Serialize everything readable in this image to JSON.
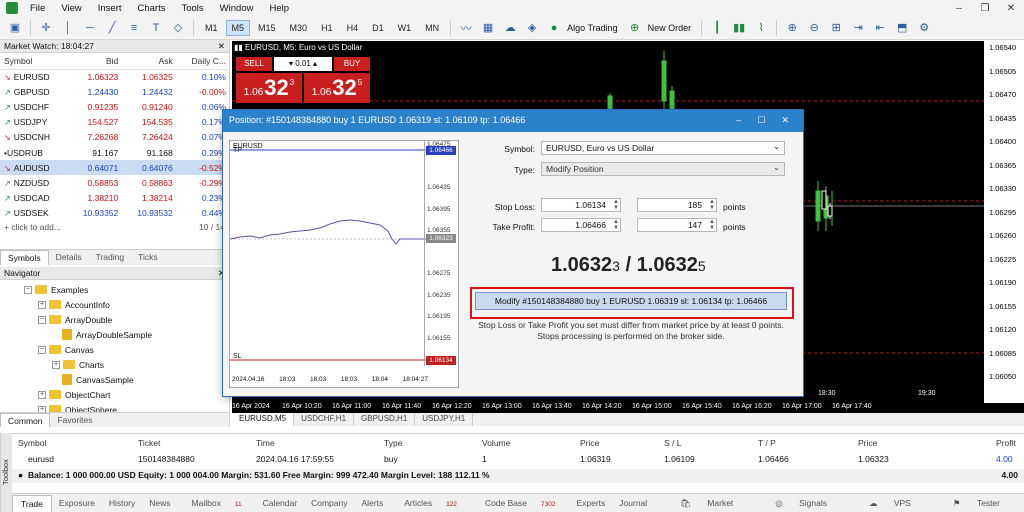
{
  "menu": [
    "File",
    "View",
    "Insert",
    "Charts",
    "Tools",
    "Window",
    "Help"
  ],
  "toolbar": {
    "timeframes": [
      "M1",
      "M5",
      "M15",
      "M30",
      "H1",
      "H4",
      "D1",
      "W1",
      "MN"
    ],
    "active_tf": "M5",
    "algo_trading": "Algo Trading",
    "new_order": "New Order"
  },
  "market_watch": {
    "title": "Market Watch: 18:04:27",
    "columns": [
      "Symbol",
      "Bid",
      "Ask",
      "Daily C..."
    ],
    "rows": [
      {
        "symbol": "EURUSD",
        "bid": "1.06323",
        "ask": "1.06325",
        "change": "0.10%",
        "dir": "down",
        "color": "red"
      },
      {
        "symbol": "GBPUSD",
        "bid": "1.24430",
        "ask": "1.24432",
        "change": "-0.00%",
        "dir": "up",
        "color": "blue"
      },
      {
        "symbol": "USDCHF",
        "bid": "0.91235",
        "ask": "0.91240",
        "change": "0.06%",
        "dir": "up",
        "color": "red"
      },
      {
        "symbol": "USDJPY",
        "bid": "154.527",
        "ask": "154.535",
        "change": "0.17%",
        "dir": "up",
        "color": "red"
      },
      {
        "symbol": "USDCNH",
        "bid": "7.26268",
        "ask": "7.26424",
        "change": "0.07%",
        "dir": "down",
        "color": "red"
      },
      {
        "symbol": "USDRUB",
        "bid": "91.167",
        "ask": "91.168",
        "change": "0.29%",
        "dir": "dot",
        "color": "black"
      },
      {
        "symbol": "AUDUSD",
        "bid": "0.64071",
        "ask": "0.64076",
        "change": "-0.52%",
        "dir": "down",
        "color": "blue"
      },
      {
        "symbol": "NZDUSD",
        "bid": "0.58853",
        "ask": "0.58863",
        "change": "-0.29%",
        "dir": "up",
        "color": "red"
      },
      {
        "symbol": "USDCAD",
        "bid": "1.38210",
        "ask": "1.38214",
        "change": "0.23%",
        "dir": "up",
        "color": "red"
      },
      {
        "symbol": "USDSEK",
        "bid": "10.93352",
        "ask": "10.93532",
        "change": "0.44%",
        "dir": "up",
        "color": "blue"
      }
    ],
    "add_placeholder": "+ click to add...",
    "count": "10 / 14",
    "tabs": [
      "Symbols",
      "Details",
      "Trading",
      "Ticks"
    ]
  },
  "navigator": {
    "title": "Navigator",
    "items": [
      "Examples",
      "AccountInfo",
      "ArrayDouble",
      "ArrayDoubleSample",
      "Canvas",
      "Charts",
      "CanvasSample",
      "ObjectChart",
      "ObjectSphere"
    ],
    "tabs": [
      "Common",
      "Favorites"
    ]
  },
  "chart": {
    "header": "EURUSD, M5:  Euro vs US Dollar",
    "sell_label": "SELL",
    "buy_label": "BUY",
    "lot": "0.01",
    "bid_small": "1.06",
    "bid_big": "32",
    "bid_sup": "3",
    "ask_small": "1.06",
    "ask_big": "32",
    "ask_sup": "5",
    "y_labels": [
      "1.06540",
      "1.06505",
      "1.06470",
      "1.06435",
      "1.06400",
      "1.06365",
      "1.06330",
      "1.06295",
      "1.06260",
      "1.06225",
      "1.06190",
      "1.06155",
      "1.06120",
      "1.06085",
      "1.06050"
    ],
    "x_labels": [
      "16 Apr 2024",
      "16 Apr 10:20",
      "16 Apr 11:00",
      "16 Apr 11:40",
      "16 Apr 12:20",
      "16 Apr 13:00",
      "16 Apr 13:40",
      "16 Apr 14:20",
      "16 Apr 15:00",
      "16 Apr 15:40",
      "16 Apr 16:20",
      "16 Apr 17:00",
      "16 Apr 17:40"
    ],
    "time_right": [
      "18:30",
      "19:30"
    ],
    "tabs": [
      "EURUSD,M5",
      "USDCHF,H1",
      "GBPUSD,H1",
      "USDJPY,H1"
    ]
  },
  "dialog": {
    "title": "Position: #150148384880 buy 1 EURUSD 1.06319 sl: 1.06109 tp: 1.06466",
    "symbol_label": "Symbol:",
    "symbol_value": "EURUSD, Euro vs US Dollar",
    "type_label": "Type:",
    "type_value": "Modify Position",
    "sl_label": "Stop Loss:",
    "sl_value": "1.06134",
    "sl_points": "185",
    "tp_label": "Take Profit:",
    "tp_value": "1.06466",
    "tp_points": "147",
    "points_label": "points",
    "price_bid": "1.0632",
    "price_bid_sub": "3",
    "price_sep": " / ",
    "price_ask": "1.0632",
    "price_ask_sub": "5",
    "modify_button": "Modify #150148384880 buy 1 EURUSD 1.06319 sl: 1.06134 tp: 1.06466",
    "note1": "Stop Loss or Take Profit you set must differ from market price by at least 0 points.",
    "note2": "Stops processing is performed on the broker side.",
    "mini_symbol": "EURUSD",
    "mini_tp": "TP",
    "mini_sl": "SL",
    "mini_y": [
      "1.06475",
      "1.06466",
      "1.06435",
      "1.06395",
      "1.06355",
      "1.06323",
      "1.06275",
      "1.06235",
      "1.06195",
      "1.06155",
      "1.06134"
    ],
    "mini_x": [
      "2024.04.16",
      "18:03",
      "18:03",
      "18:03",
      "18:04",
      "18:04:27"
    ],
    "tag_tp": "1.06466",
    "tag_cur": "1.06323",
    "tag_sl": "1.06134"
  },
  "terminal": {
    "headers": [
      "Symbol",
      "Ticket",
      "Time",
      "Type",
      "Volume",
      "Price",
      "S / L",
      "T / P",
      "Price",
      "Profit"
    ],
    "row": [
      "eurusd",
      "150148384880",
      "2024.04.16 17:59:55",
      "buy",
      "1",
      "1.06319",
      "1.06109",
      "1.06466",
      "1.06323",
      "4.00"
    ],
    "balance": "Balance: 1 000 000.00 USD  Equity: 1 000 004.00  Margin: 531.60  Free Margin: 999 472.40  Margin Level: 188 112.11 %",
    "balance_profit": "4.00",
    "tabs": [
      "Trade",
      "Exposure",
      "History",
      "News",
      "Mailbox",
      "Calendar",
      "Company",
      "Alerts",
      "Articles",
      "Code Base",
      "Experts",
      "Journal"
    ],
    "mailbox_badge": "11",
    "articles_badge": "122",
    "codebase_badge": "7302",
    "status": [
      "Market",
      "Signals",
      "VPS",
      "Tester"
    ],
    "toolbox": "Toolbox"
  }
}
